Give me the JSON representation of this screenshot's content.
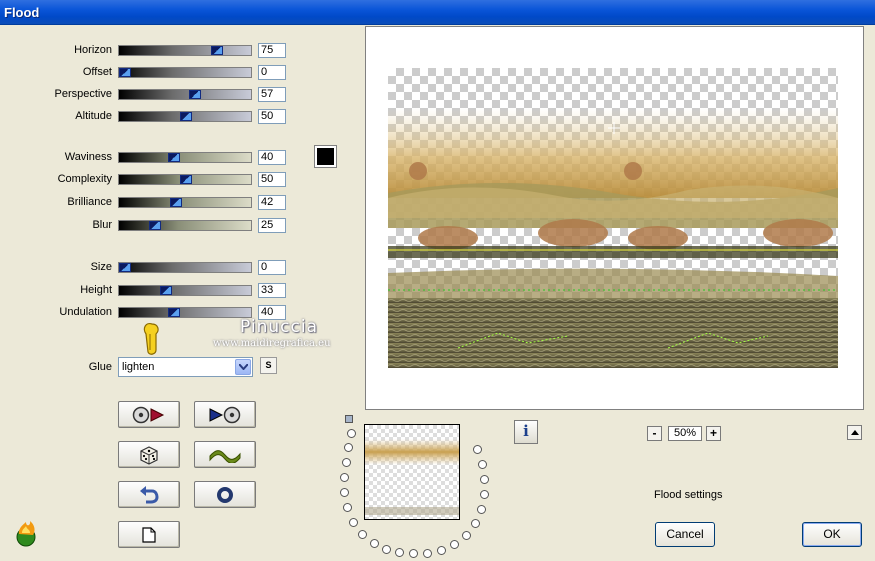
{
  "window": {
    "title": "Flood"
  },
  "params": {
    "horizon": {
      "label": "Horizon",
      "value": "75"
    },
    "offset": {
      "label": "Offset",
      "value": "0"
    },
    "perspective": {
      "label": "Perspective",
      "value": "57"
    },
    "altitude": {
      "label": "Altitude",
      "value": "50"
    },
    "waviness": {
      "label": "Waviness",
      "value": "40"
    },
    "complexity": {
      "label": "Complexity",
      "value": "50"
    },
    "brilliance": {
      "label": "Brilliance",
      "value": "42"
    },
    "blur": {
      "label": "Blur",
      "value": "25"
    },
    "size": {
      "label": "Size",
      "value": "0"
    },
    "height": {
      "label": "Height",
      "value": "33"
    },
    "undulation": {
      "label": "Undulation",
      "value": "40"
    }
  },
  "color_swatch": "#000000",
  "glue": {
    "label": "Glue",
    "value": "lighten",
    "s_button": "S"
  },
  "watermark": {
    "name": "Pinuccia",
    "url": "www.maidiregrafica.eu"
  },
  "zoom": {
    "value": "50%",
    "minus": "-",
    "plus": "+"
  },
  "info_button": "i",
  "settings_label": "Flood settings",
  "buttons": {
    "cancel": "Cancel",
    "ok": "OK"
  },
  "icons": {
    "open_preset": "cd-arrow-icon",
    "save_preset": "arrow-cd-icon",
    "randomize": "dice-icon",
    "wave": "wave-icon",
    "undo": "undo-arrow-icon",
    "reset": "ring-icon",
    "copy": "page-icon",
    "logo": "flame-logo-icon",
    "pointer": "hand-pointer-icon"
  }
}
